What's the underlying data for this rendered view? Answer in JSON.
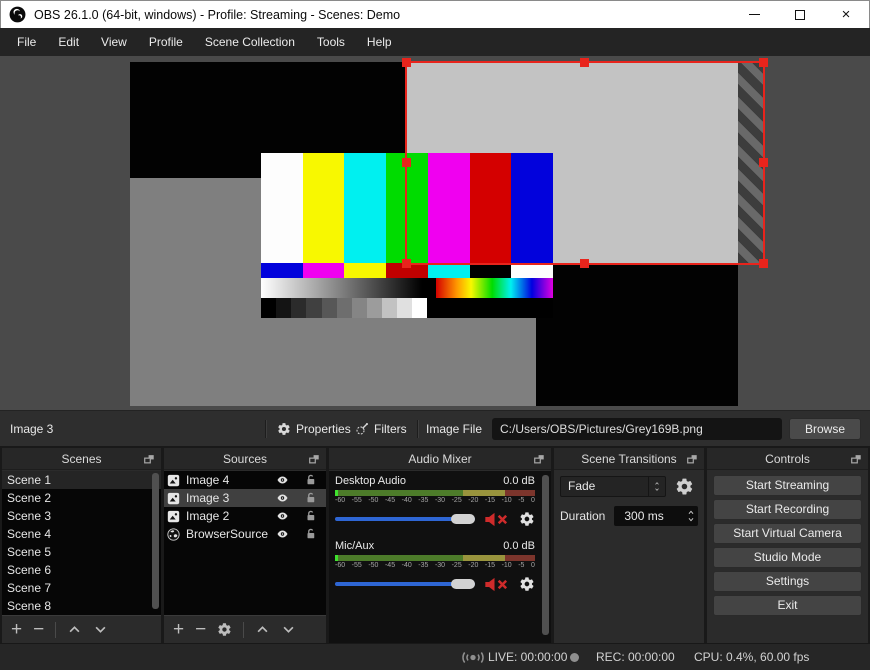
{
  "window": {
    "title": "OBS 26.1.0 (64-bit, windows) - Profile: Streaming - Scenes: Demo"
  },
  "menu": {
    "items": [
      "File",
      "Edit",
      "View",
      "Profile",
      "Scene Collection",
      "Tools",
      "Help"
    ]
  },
  "source_toolbar": {
    "selected_source": "Image 3",
    "properties": "Properties",
    "filters": "Filters",
    "image_file_label": "Image File",
    "image_file_value": "C:/Users/OBS/Pictures/Grey169B.png",
    "browse": "Browse"
  },
  "preview": {
    "selection_color": "#e8241c",
    "test_pattern": {
      "bars": [
        "#fdfdfd",
        "#f8f800",
        "#00f0f0",
        "#00dc00",
        "#f000f0",
        "#d40000",
        "#0202dc"
      ],
      "small_bars": [
        "#0202dc",
        "#f000f0",
        "#f8f800",
        "#c00000",
        "#00f0f0",
        "#000000",
        "#fdfdfd"
      ],
      "gray_steps": [
        "#000000",
        "#141414",
        "#2b2b2b",
        "#404040",
        "#575757",
        "#6e6e6e",
        "#858585",
        "#9c9c9c",
        "#c2c2c2",
        "#e0e0e0",
        "#ffffff"
      ]
    }
  },
  "scenes": {
    "title": "Scenes",
    "items": [
      "Scene 1",
      "Scene 2",
      "Scene 3",
      "Scene 4",
      "Scene 5",
      "Scene 6",
      "Scene 7",
      "Scene 8"
    ],
    "selected": "Scene 1"
  },
  "sources": {
    "title": "Sources",
    "items": [
      "Image 4",
      "Image 3",
      "Image 2",
      "BrowserSource"
    ],
    "selected": "Image 3"
  },
  "mixer": {
    "title": "Audio Mixer",
    "ticks": [
      "-60",
      "-55",
      "-50",
      "-45",
      "-40",
      "-35",
      "-30",
      "-25",
      "-20",
      "-15",
      "-10",
      "-5",
      "0"
    ],
    "channels": [
      {
        "name": "Desktop Audio",
        "level": "0.0 dB"
      },
      {
        "name": "Mic/Aux",
        "level": "0.0 dB"
      }
    ],
    "meter_colors": {
      "green": "#4d7c2a",
      "yellow": "#99943d",
      "red": "#7c352c"
    },
    "slider_color": "#2e66d4"
  },
  "transitions": {
    "title": "Scene Transitions",
    "selected": "Fade",
    "duration_label": "Duration",
    "duration_value": "300 ms"
  },
  "controls_panel": {
    "title": "Controls",
    "buttons": [
      "Start Streaming",
      "Start Recording",
      "Start Virtual Camera",
      "Studio Mode",
      "Settings",
      "Exit"
    ]
  },
  "status": {
    "live": "LIVE: 00:00:00",
    "rec": "REC: 00:00:00",
    "cpu": "CPU: 0.4%, 60.00 fps"
  },
  "colors": {
    "accent_blue": "#2e66d4",
    "selection_red": "#e8241c",
    "mute_red": "#cf2b2b"
  }
}
